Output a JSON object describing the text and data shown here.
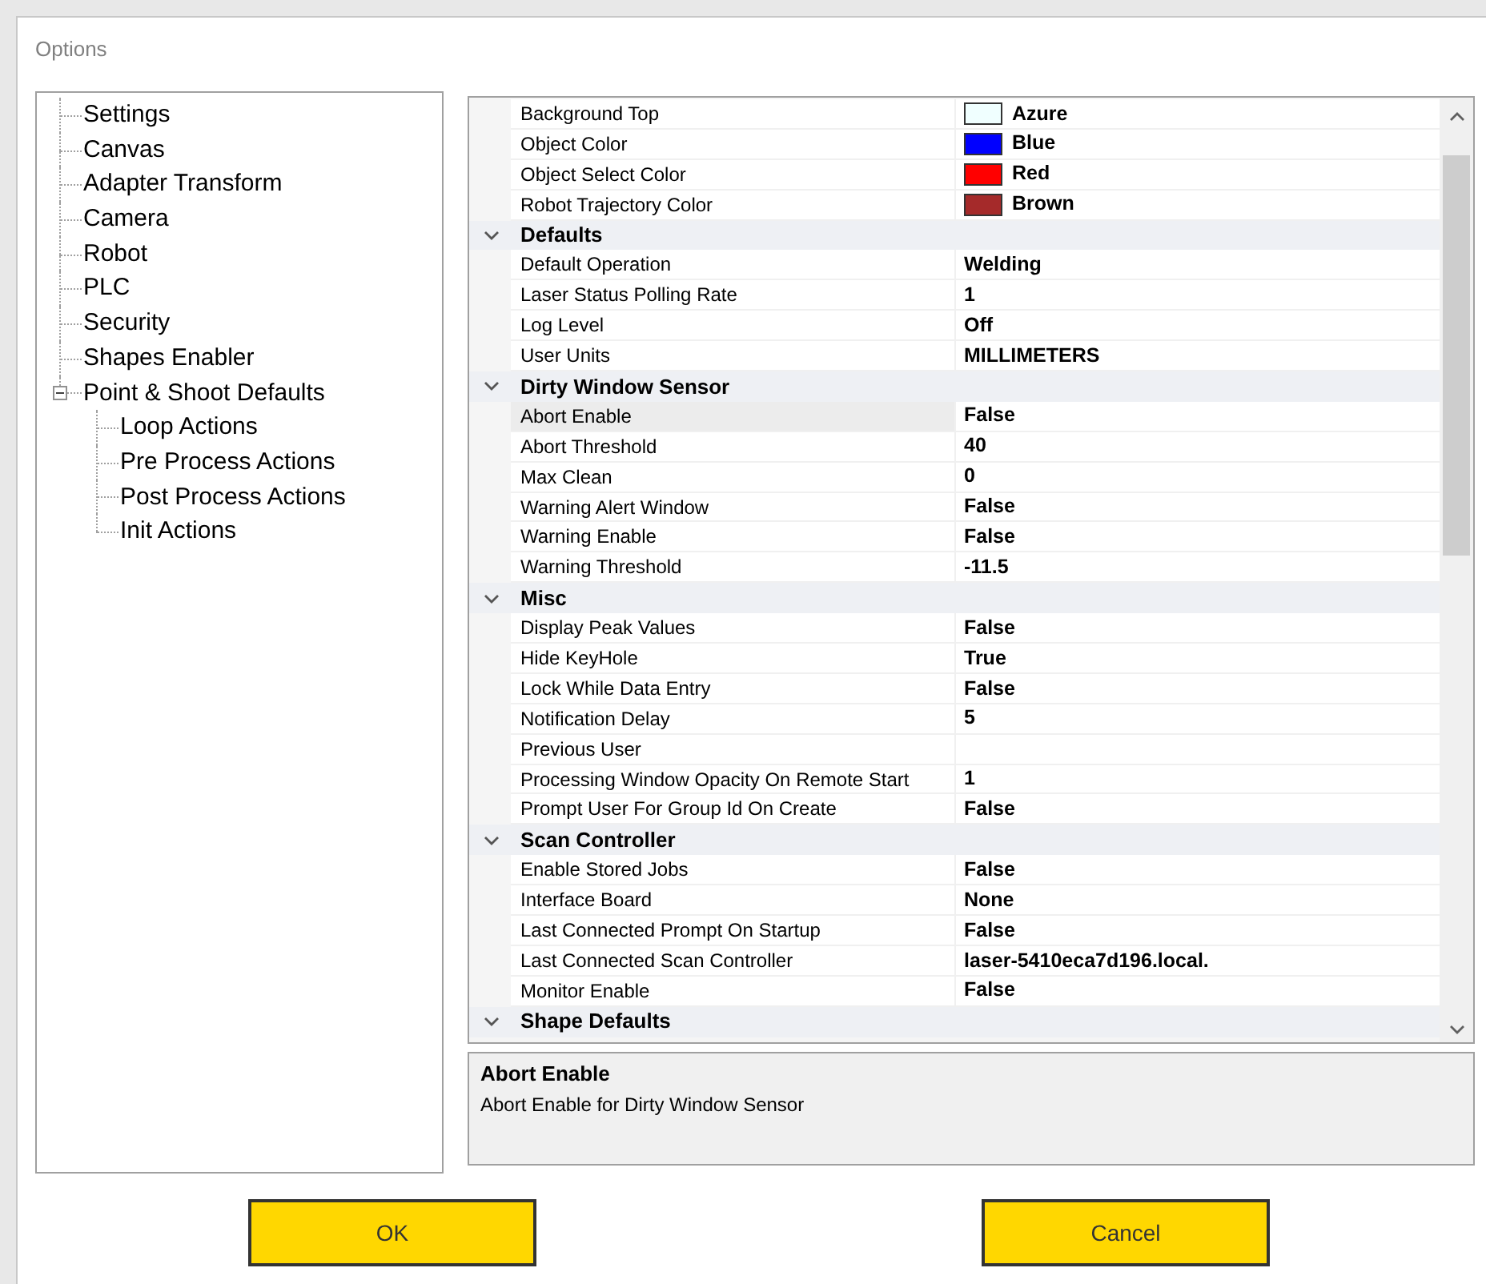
{
  "window": {
    "title": "Options"
  },
  "tree": [
    {
      "label": "Settings"
    },
    {
      "label": "Canvas"
    },
    {
      "label": "Adapter Transform"
    },
    {
      "label": "Camera"
    },
    {
      "label": "Robot"
    },
    {
      "label": "PLC"
    },
    {
      "label": "Security"
    },
    {
      "label": "Shapes Enabler"
    },
    {
      "label": "Point & Shoot Defaults",
      "expanded": true,
      "children": [
        {
          "label": "Loop Actions"
        },
        {
          "label": "Pre Process Actions"
        },
        {
          "label": "Post Process Actions"
        },
        {
          "label": "Init Actions"
        }
      ]
    }
  ],
  "property_grid": {
    "sections": [
      {
        "rows": [
          {
            "kind": "color",
            "name": "Background Top",
            "value": "Azure",
            "color": "#f0ffff",
            "selected": false
          },
          {
            "kind": "color",
            "name": "Object Color",
            "value": "Blue",
            "color": "#0000ff",
            "selected": false
          },
          {
            "kind": "color",
            "name": "Object Select Color",
            "value": "Red",
            "color": "#ff0000",
            "selected": false
          },
          {
            "kind": "color",
            "name": "Robot Trajectory Color",
            "value": "Brown",
            "color": "#a52a2a",
            "selected": false
          }
        ]
      },
      {
        "title": "Defaults",
        "expanded": true,
        "rows": [
          {
            "kind": "text",
            "name": "Default Operation",
            "value": "Welding",
            "selected": false
          },
          {
            "kind": "text",
            "name": "Laser Status Polling Rate",
            "value": "1",
            "selected": false
          },
          {
            "kind": "text",
            "name": "Log Level",
            "value": "Off",
            "selected": false
          },
          {
            "kind": "text",
            "name": "User Units",
            "value": "MILLIMETERS",
            "selected": false
          }
        ]
      },
      {
        "title": "Dirty Window Sensor",
        "expanded": true,
        "rows": [
          {
            "kind": "text",
            "name": "Abort Enable",
            "value": "False",
            "selected": true
          },
          {
            "kind": "text",
            "name": "Abort Threshold",
            "value": "40",
            "selected": false
          },
          {
            "kind": "text",
            "name": "Max Clean",
            "value": "0",
            "selected": false
          },
          {
            "kind": "text",
            "name": "Warning Alert Window",
            "value": "False",
            "selected": false
          },
          {
            "kind": "text",
            "name": "Warning Enable",
            "value": "False",
            "selected": false
          },
          {
            "kind": "text",
            "name": "Warning Threshold",
            "value": "-11.5",
            "selected": false
          }
        ]
      },
      {
        "title": "Misc",
        "expanded": true,
        "rows": [
          {
            "kind": "text",
            "name": "Display Peak Values",
            "value": "False",
            "selected": false
          },
          {
            "kind": "text",
            "name": "Hide KeyHole",
            "value": "True",
            "selected": false
          },
          {
            "kind": "text",
            "name": "Lock While Data Entry",
            "value": "False",
            "selected": false
          },
          {
            "kind": "text",
            "name": "Notification Delay",
            "value": "5",
            "selected": false
          },
          {
            "kind": "text",
            "name": "Previous User",
            "selected": false
          },
          {
            "kind": "text",
            "name": "Processing Window Opacity On Remote Start",
            "value": "1",
            "selected": false
          },
          {
            "kind": "text",
            "name": "Prompt User For Group Id On Create",
            "value": "False",
            "selected": false
          }
        ]
      },
      {
        "title": "Scan Controller",
        "expanded": true,
        "rows": [
          {
            "kind": "text",
            "name": "Enable Stored Jobs",
            "value": "False",
            "selected": false
          },
          {
            "kind": "text",
            "name": "Interface Board",
            "value": "None",
            "selected": false
          },
          {
            "kind": "text",
            "name": "Last Connected Prompt On Startup",
            "value": "False",
            "selected": false
          },
          {
            "kind": "text",
            "name": "Last Connected Scan Controller",
            "value": "laser-5410eca7d196.local.",
            "selected": false
          },
          {
            "kind": "text",
            "name": "Monitor Enable",
            "value": "False",
            "selected": false
          }
        ]
      },
      {
        "title": "Shape Defaults",
        "expanded": true
      }
    ]
  },
  "description": {
    "title": "Abort Enable",
    "text": "Abort Enable for Dirty Window Sensor"
  },
  "buttons": [
    {
      "label": "OK"
    },
    {
      "label": "Cancel"
    }
  ]
}
